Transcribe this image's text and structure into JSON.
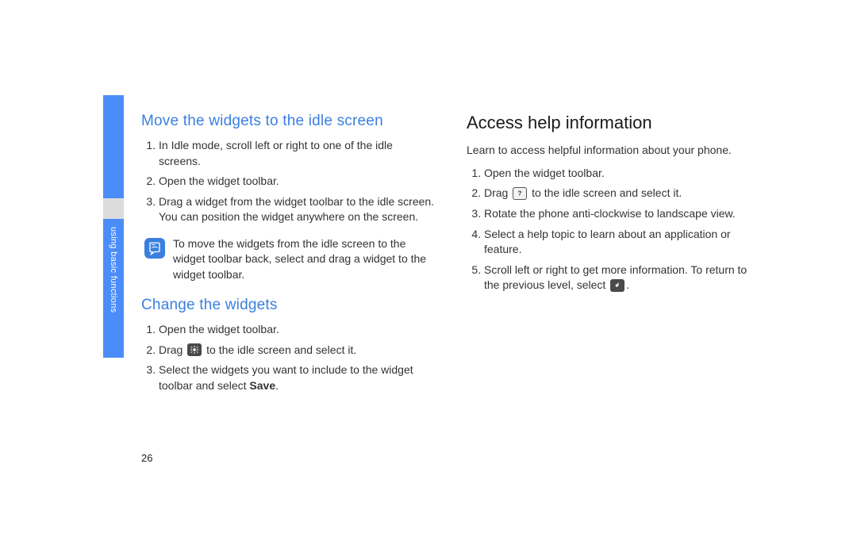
{
  "sidebar": {
    "label": "using basic functions"
  },
  "left": {
    "section1": {
      "heading": "Move the widgets to the idle screen",
      "step1": "In Idle mode, scroll left or right to one of the idle screens.",
      "step2": "Open the widget toolbar.",
      "step3": "Drag a widget from the widget toolbar to the idle screen. You can position the widget anywhere on the screen.",
      "note": "To move the widgets from the idle screen to the widget toolbar back, select and drag a widget to the widget toolbar."
    },
    "section2": {
      "heading": "Change the widgets",
      "step1": "Open the widget toolbar.",
      "step2_pre": "Drag ",
      "step2_post": " to the idle screen and select it.",
      "step3_pre": "Select the widgets you want to include to the widget toolbar and select ",
      "step3_bold": "Save",
      "step3_post": "."
    }
  },
  "right": {
    "heading": "Access help information",
    "intro": "Learn to access helpful information about your phone.",
    "step1": "Open the widget toolbar.",
    "step2_pre": "Drag ",
    "step2_post": " to the idle screen and select it.",
    "step3": "Rotate the phone anti-clockwise to landscape view.",
    "step4": "Select a help topic to learn about an application or feature.",
    "step5_pre": "Scroll left or right to get more information. To return to the previous level, select ",
    "step5_post": "."
  },
  "pagenum": "26"
}
